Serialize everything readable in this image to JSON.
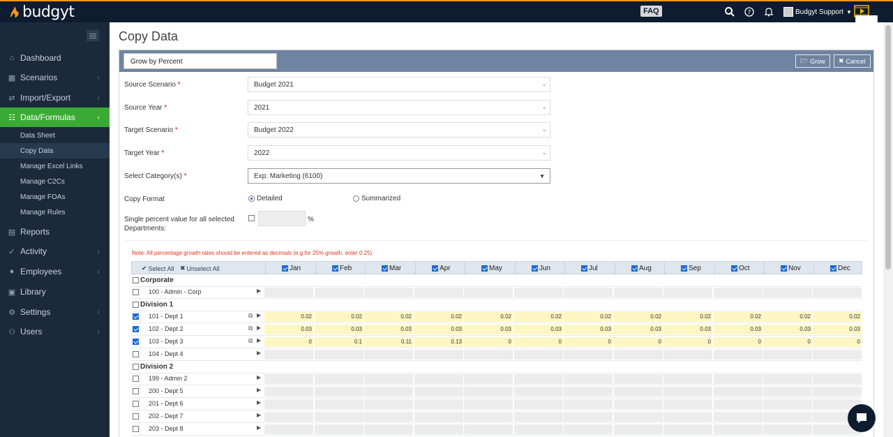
{
  "app": {
    "name": "budgyt",
    "faq_label": "FAQ",
    "user_label": "Budgyt Support",
    "accent": "#3aaa35",
    "brand_orange": "#f7941d"
  },
  "sidebar": {
    "items": [
      {
        "label": "Dashboard",
        "icon": "home-icon"
      },
      {
        "label": "Scenarios",
        "icon": "bar-chart-icon"
      },
      {
        "label": "Import/Export",
        "icon": "exchange-icon"
      },
      {
        "label": "Data/Formulas",
        "icon": "database-icon"
      },
      {
        "label": "Reports",
        "icon": "file-icon"
      },
      {
        "label": "Activity",
        "icon": "activity-icon"
      },
      {
        "label": "Employees",
        "icon": "user-icon"
      },
      {
        "label": "Library",
        "icon": "library-icon"
      },
      {
        "label": "Settings",
        "icon": "gear-icon"
      },
      {
        "label": "Users",
        "icon": "users-icon"
      }
    ],
    "subitems": [
      "Data Sheet",
      "Copy Data",
      "Manage Excel Links",
      "Manage C2Cs",
      "Manage FOAs",
      "Manage Rules"
    ]
  },
  "page": {
    "title": "Copy Data"
  },
  "toolbar": {
    "method": "Grow by Percent",
    "grow_label": "Grow",
    "cancel_label": "Cancel"
  },
  "form": {
    "source_scenario_label": "Source Scenario",
    "source_scenario": "Budget 2021",
    "source_year_label": "Source Year",
    "source_year": "2021",
    "target_scenario_label": "Target Scenario",
    "target_scenario": "Budget 2022",
    "target_year_label": "Target Year",
    "target_year": "2022",
    "category_label": "Select Category(s)",
    "category": "Exp: Marketing (6100)",
    "copy_format_label": "Copy Format",
    "format_detailed": "Detailed",
    "format_summarized": "Summarized",
    "single_pct_label_1": "Single percent value for all selected",
    "single_pct_label_2": "Departments:",
    "pct_symbol": "%",
    "required_mark": "*"
  },
  "note": "Note: All percentage growth rates should be entered as decimals (e.g for 25% growth, enter 0.25)",
  "grid": {
    "select_all": "Select All",
    "unselect_all": "Unselect All",
    "months": [
      "Jan",
      "Feb",
      "Mar",
      "Apr",
      "May",
      "Jun",
      "Jul",
      "Aug",
      "Sep",
      "Oct",
      "Nov",
      "Dec"
    ],
    "rows": [
      {
        "type": "group",
        "name": "Corporate",
        "checked": false
      },
      {
        "type": "dept",
        "name": "100 - Admin - Corp",
        "checked": false,
        "values": null
      },
      {
        "type": "group",
        "name": "Division 1",
        "checked": false
      },
      {
        "type": "dept",
        "name": "101 - Dept 1",
        "checked": true,
        "copy": true,
        "values": [
          "0.02",
          "0.02",
          "0.02",
          "0.02",
          "0.02",
          "0.02",
          "0.02",
          "0.02",
          "0.02",
          "0.02",
          "0.02",
          "0.02"
        ]
      },
      {
        "type": "dept",
        "name": "102 - Dept 2",
        "checked": true,
        "copy": true,
        "values": [
          "0.03",
          "0.03",
          "0.03",
          "0.03",
          "0.03",
          "0.03",
          "0.03",
          "0.03",
          "0.03",
          "0.03",
          "0.03",
          "0.03"
        ]
      },
      {
        "type": "dept",
        "name": "103 - Dept 3",
        "checked": true,
        "copy": true,
        "values": [
          "0",
          "0.1",
          "0.11",
          "0.13",
          "0",
          "0",
          "0",
          "0",
          "0",
          "0",
          "0",
          "0"
        ]
      },
      {
        "type": "dept",
        "name": "104 - Dept 4",
        "checked": false,
        "values": null
      },
      {
        "type": "group",
        "name": "Division 2",
        "checked": false
      },
      {
        "type": "dept",
        "name": "199 - Admin 2",
        "checked": false,
        "values": null
      },
      {
        "type": "dept",
        "name": "200 - Dept 5",
        "checked": false,
        "values": null
      },
      {
        "type": "dept",
        "name": "201 - Dept 6",
        "checked": false,
        "values": null
      },
      {
        "type": "dept",
        "name": "202 - Dept 7",
        "checked": false,
        "values": null
      },
      {
        "type": "dept",
        "name": "203 - Dept 8",
        "checked": false,
        "values": null
      }
    ]
  }
}
